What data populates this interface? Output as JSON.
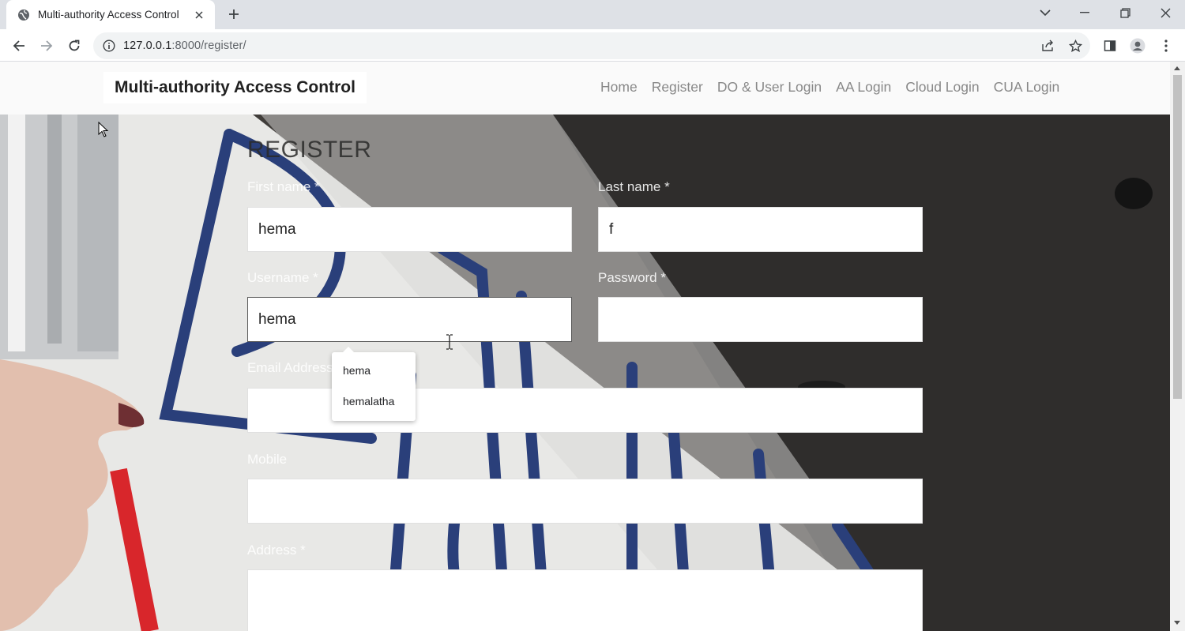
{
  "browser": {
    "tab_title": "Multi-authority Access Control",
    "url_host": "127.0.0.1",
    "url_path": ":8000/register/"
  },
  "page": {
    "brand": "Multi-authority Access Control",
    "nav": [
      "Home",
      "Register",
      "DO & User Login",
      "AA Login",
      "Cloud Login",
      "CUA Login"
    ]
  },
  "form": {
    "title": "REGISTER",
    "first_name": {
      "label": "First name *",
      "value": "hema"
    },
    "last_name": {
      "label": "Last name *",
      "value": "f"
    },
    "username": {
      "label": "Username *",
      "value": "hema"
    },
    "password": {
      "label": "Password *",
      "value": ""
    },
    "email": {
      "label": "Email Address",
      "value": ""
    },
    "mobile": {
      "label": "Mobile",
      "value": ""
    },
    "address": {
      "label": "Address *",
      "value": ""
    }
  },
  "autocomplete": [
    "hema",
    "hemalatha"
  ],
  "colors": {
    "accent": "#1a73e8",
    "hero_dark": "#3c3a38",
    "marker_blue": "#2a3f7a",
    "marker_red": "#d8262b"
  }
}
